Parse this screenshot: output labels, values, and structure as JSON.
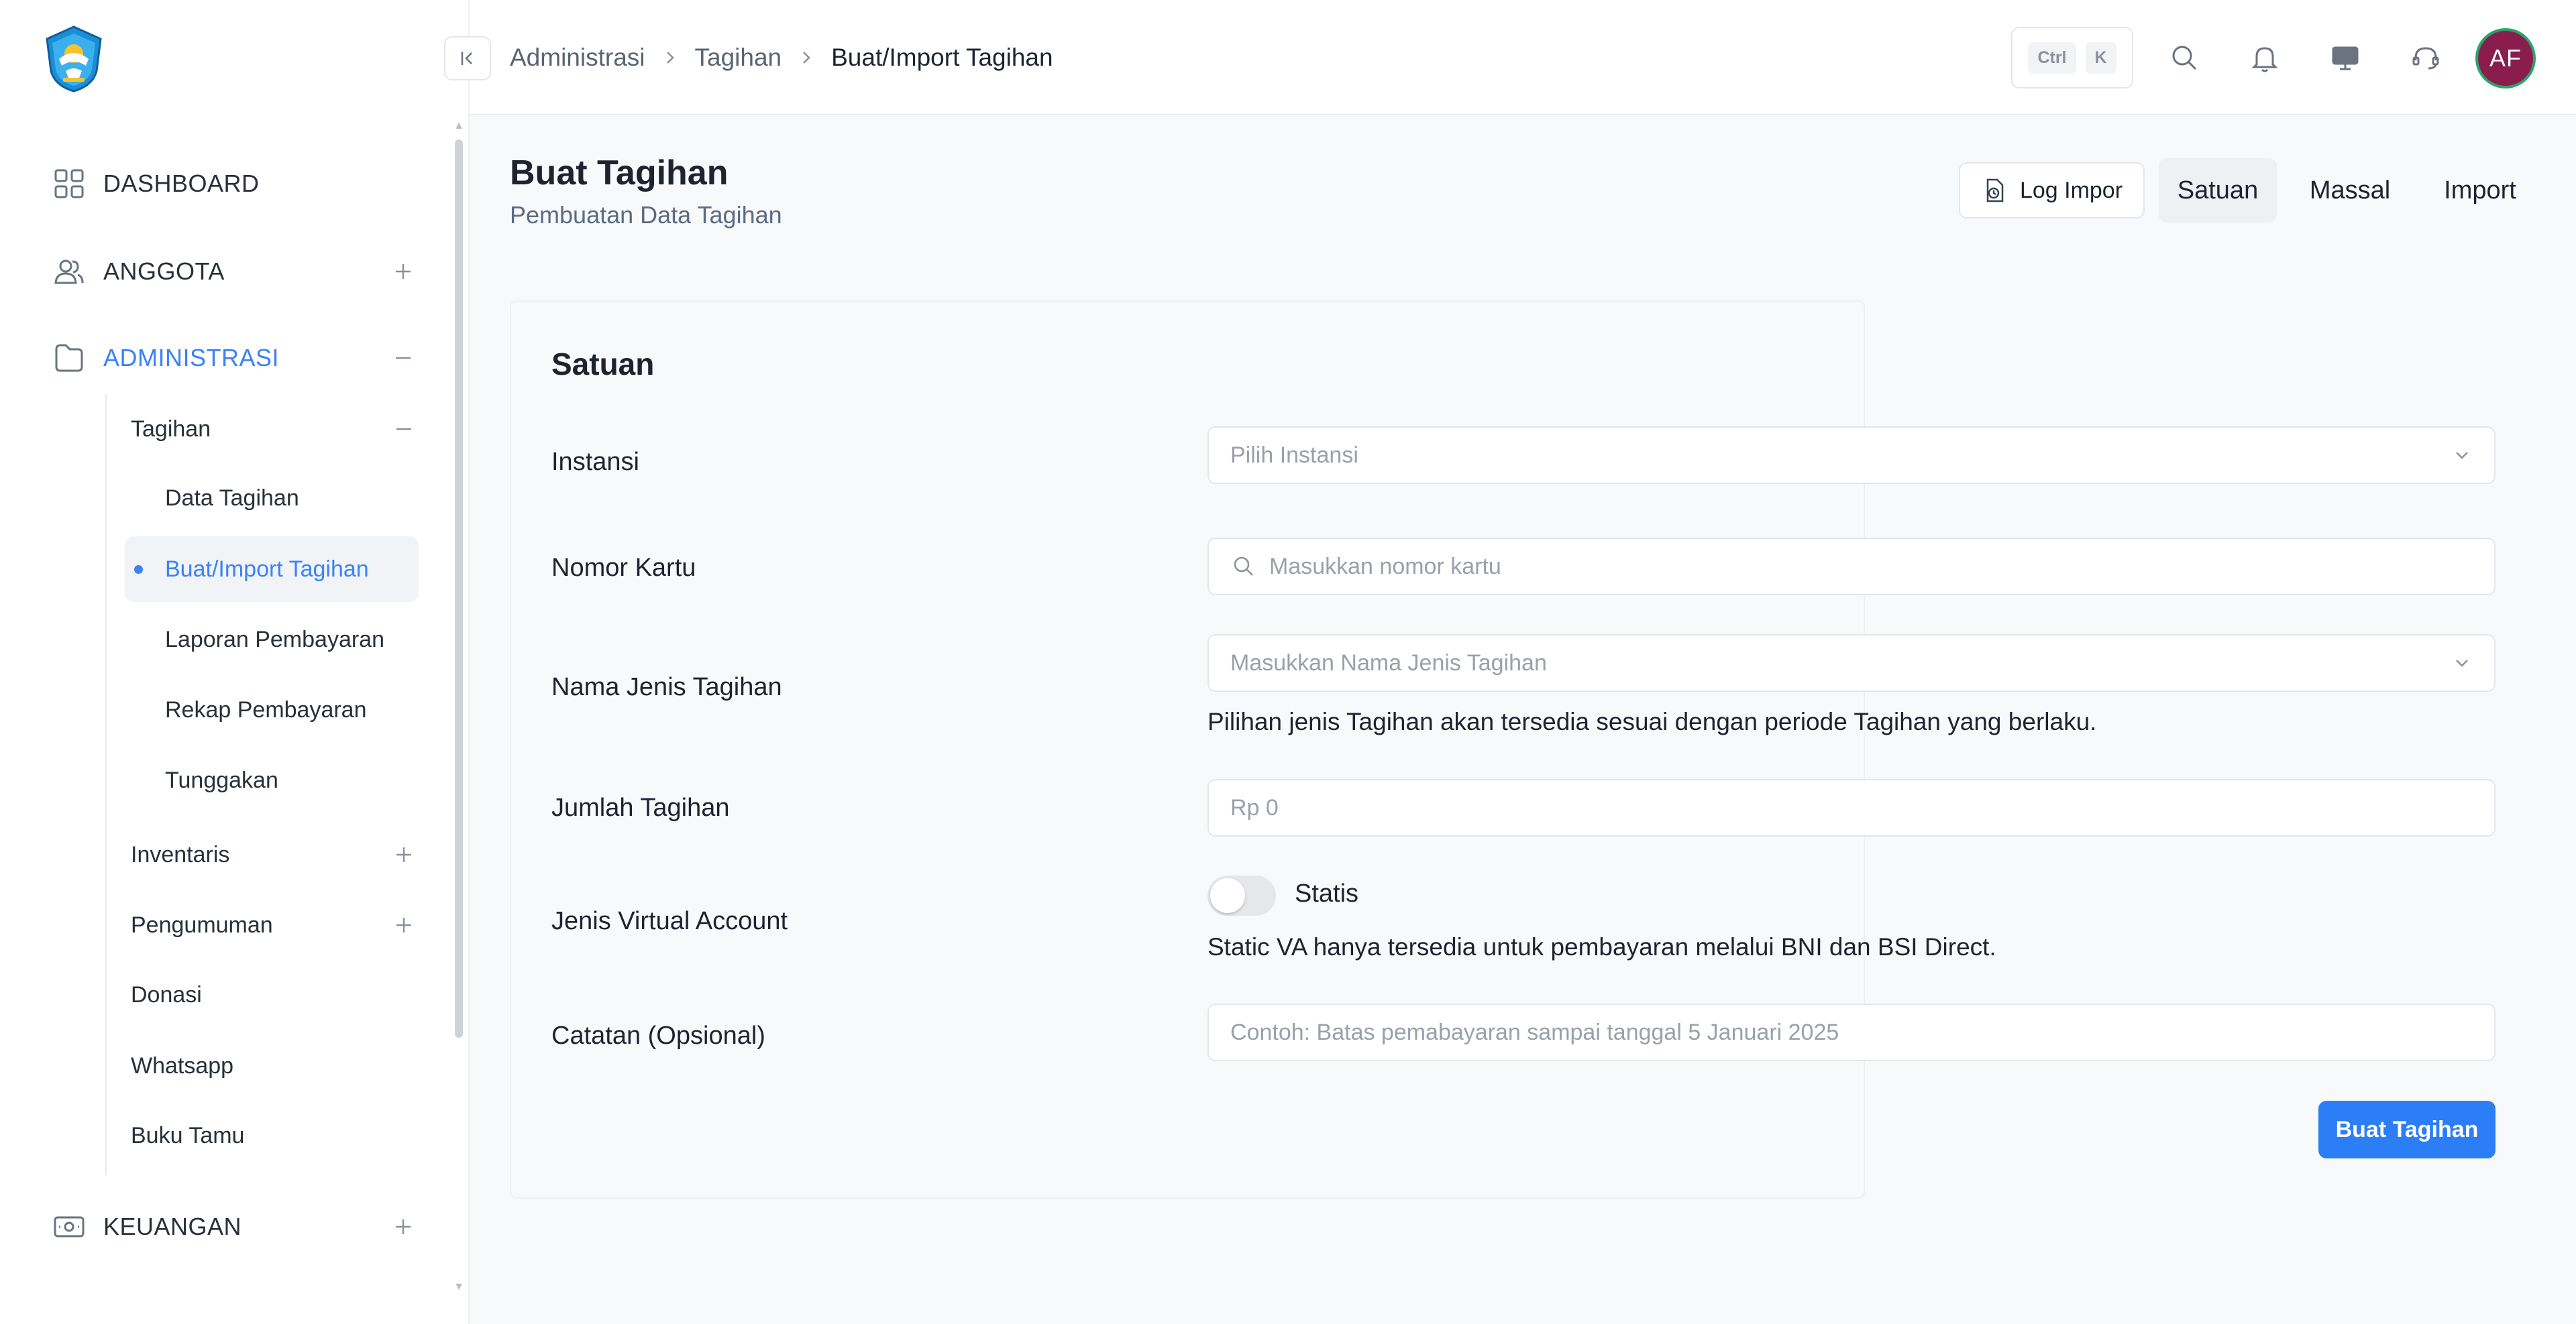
{
  "sidebar": {
    "items": [
      {
        "label": "DASHBOARD"
      },
      {
        "label": "ANGGOTA"
      },
      {
        "label": "ADMINISTRASI"
      },
      {
        "label": "KEUANGAN"
      }
    ],
    "administrasi": {
      "tagihan_label": "Tagihan",
      "tagihan_sub": [
        {
          "label": "Data Tagihan"
        },
        {
          "label": "Buat/Import Tagihan"
        },
        {
          "label": "Laporan Pembayaran"
        },
        {
          "label": "Rekap Pembayaran"
        },
        {
          "label": "Tunggakan"
        }
      ],
      "others": [
        {
          "label": "Inventaris"
        },
        {
          "label": "Pengumuman"
        },
        {
          "label": "Donasi"
        },
        {
          "label": "Whatsapp"
        },
        {
          "label": "Buku Tamu"
        }
      ]
    }
  },
  "breadcrumb": [
    "Administrasi",
    "Tagihan",
    "Buat/Import Tagihan"
  ],
  "shortcut": {
    "key1": "Ctrl",
    "key2": "K"
  },
  "user": {
    "initials": "AF"
  },
  "page": {
    "title": "Buat Tagihan",
    "subtitle": "Pembuatan Data Tagihan",
    "log_button": "Log Impor",
    "tabs": [
      "Satuan",
      "Massal",
      "Import"
    ]
  },
  "form": {
    "title": "Satuan",
    "instansi": {
      "label": "Instansi",
      "placeholder": "Pilih Instansi"
    },
    "nomor_kartu": {
      "label": "Nomor Kartu",
      "placeholder": "Masukkan nomor kartu"
    },
    "jenis_tagihan": {
      "label": "Nama Jenis Tagihan",
      "placeholder": "Masukkan Nama Jenis Tagihan",
      "help": "Pilihan jenis Tagihan akan tersedia sesuai dengan periode Tagihan yang berlaku."
    },
    "jumlah": {
      "label": "Jumlah Tagihan",
      "placeholder": "Rp 0"
    },
    "virtual_account": {
      "label": "Jenis Virtual Account",
      "toggle_label": "Statis",
      "help": "Static VA hanya tersedia untuk pembayaran melalui BNI dan BSI Direct."
    },
    "catatan": {
      "label": "Catatan (Opsional)",
      "placeholder": "Contoh: Batas pemabayaran sampai tanggal 5 Januari 2025"
    },
    "submit": "Buat Tagihan"
  },
  "colors": {
    "accent": "#2c7ef6",
    "avatar_bg": "#8b1d4e",
    "avatar_ring": "#2aa567"
  }
}
